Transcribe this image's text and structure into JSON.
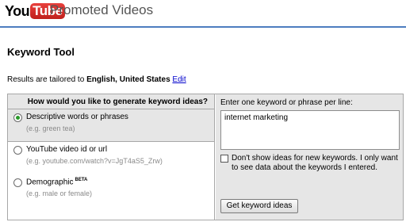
{
  "header": {
    "logo_you": "You",
    "logo_tube": "Tube",
    "title": "Promoted Videos"
  },
  "section_title": "Keyword Tool",
  "tailored": {
    "prefix": "Results are tailored to ",
    "locale": "English, United States",
    "edit_link": "Edit"
  },
  "left_panel": {
    "question": "How would you like to generate keyword ideas?",
    "options": [
      {
        "label": "Descriptive words or phrases",
        "hint": "(e.g. green tea)",
        "selected": true
      },
      {
        "label": "YouTube video id or url",
        "hint": "(e.g. youtube.com/watch?v=JgT4aS5_Zrw)",
        "selected": false
      },
      {
        "label": "Demographic",
        "badge": "BETA",
        "hint": "(e.g. male or female)",
        "selected": false
      }
    ]
  },
  "right_panel": {
    "instruction": "Enter one keyword or phrase per line:",
    "keywords_value": "internet marketing",
    "checkbox_label": "Don't show ideas for new keywords. I only want to see data about the keywords I entered.",
    "checkbox_checked": false,
    "submit_label": "Get keyword ideas"
  },
  "colors": {
    "header_rule": "#4d7dbf",
    "link": "#0000cc",
    "panel_shade": "#e6e6e6",
    "logo_red": "#c0201c"
  }
}
